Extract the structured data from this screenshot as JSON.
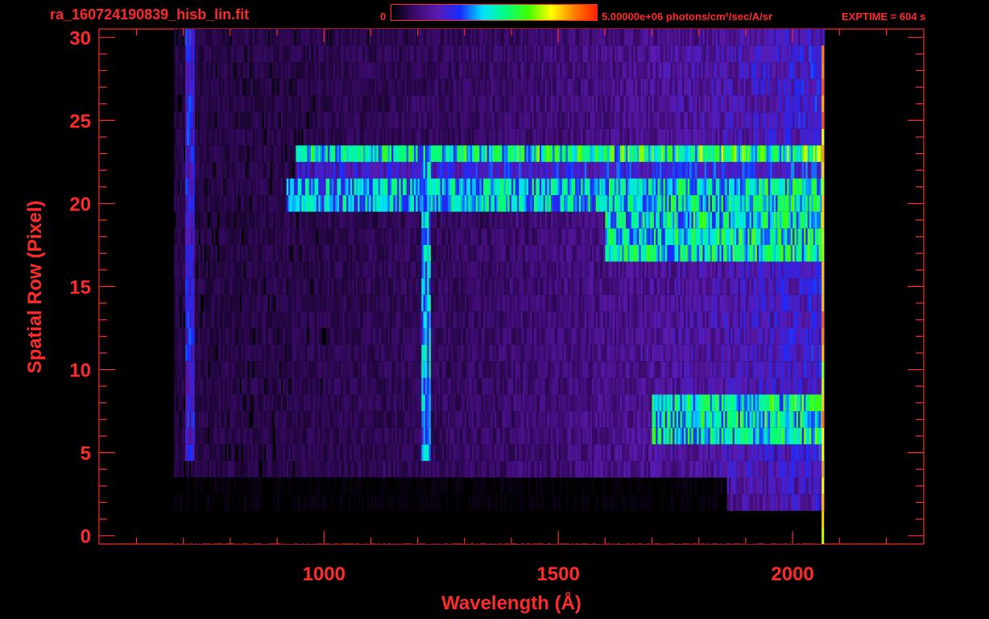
{
  "header": {
    "title": "ra_160724190839_hisb_lin.fit",
    "colorbar_min": "0",
    "colorbar_max_label": "5.00000e+06 photons/cm²/sec/A/sr",
    "exptime": "EXPTIME = 604 s"
  },
  "colors": {
    "axis": "#ff2a2a",
    "background": "#000000"
  },
  "colormap": [
    "#000000",
    "#3a0a6a",
    "#5a1ab0",
    "#1a2aff",
    "#00e0ff",
    "#00ff80",
    "#40ff00",
    "#ffff00",
    "#ff8000",
    "#ff2000"
  ],
  "chart_data": {
    "type": "heatmap",
    "title": "ra_160724190839_hisb_lin.fit",
    "xlabel": "Wavelength (Å)",
    "ylabel": "Spatial Row (Pixel)",
    "xlim": [
      520,
      2280
    ],
    "ylim": [
      -0.5,
      30.5
    ],
    "xticks": [
      1000,
      1500,
      2000
    ],
    "yticks": [
      0,
      5,
      10,
      15,
      20,
      25,
      30
    ],
    "colorbar": {
      "min": 0,
      "max": 5000000,
      "unit": "photons/cm²/sec/A/sr"
    },
    "data_extent_x": [
      680,
      2068
    ],
    "bright_rows": [
      {
        "rows": [
          23,
          23
        ],
        "x_start": 940,
        "x_end": 2060,
        "level": 0.58
      },
      {
        "rows": [
          22,
          22
        ],
        "x_start": 940,
        "x_end": 2060,
        "level": 0.3
      },
      {
        "rows": [
          20,
          21
        ],
        "x_start": 920,
        "x_end": 2060,
        "level": 0.5
      },
      {
        "rows": [
          17,
          19
        ],
        "x_start": 1600,
        "x_end": 2060,
        "level": 0.52
      },
      {
        "rows": [
          6,
          8
        ],
        "x_start": 1700,
        "x_end": 2060,
        "level": 0.52
      }
    ],
    "emission_lines": [
      {
        "wavelength": 1216,
        "rows": [
          5,
          23
        ],
        "level": 0.45
      },
      {
        "wavelength": 712,
        "rows": [
          5,
          30
        ],
        "level": 0.3
      }
    ],
    "grid": false,
    "legend": "colorbar top"
  }
}
